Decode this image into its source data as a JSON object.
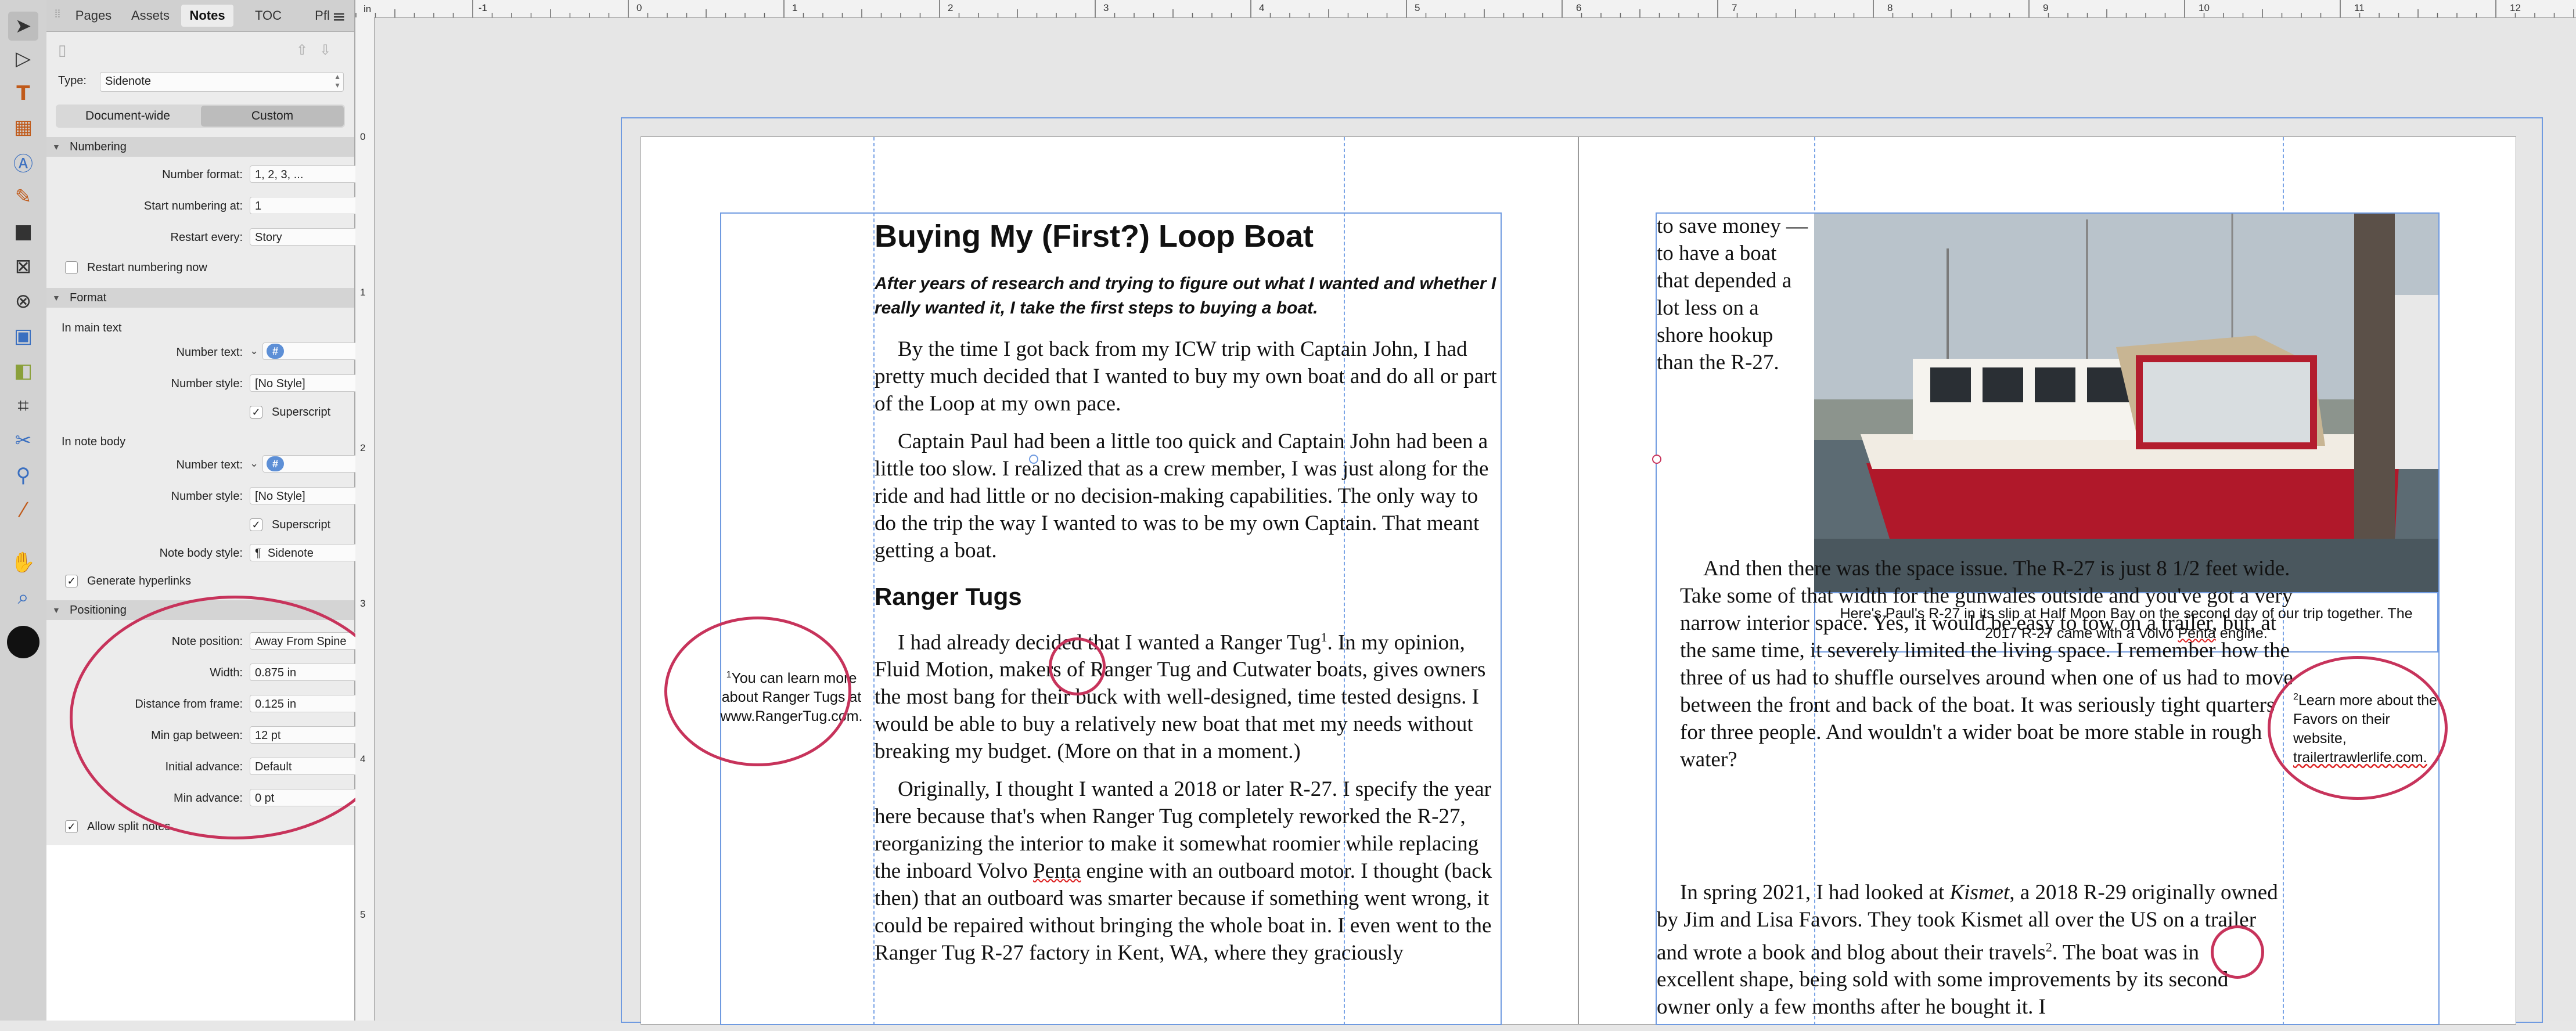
{
  "ruler": {
    "unit": "in",
    "top_labels": [
      "-1",
      "0",
      "1",
      "2",
      "3",
      "4",
      "5",
      "6",
      "7",
      "8",
      "9",
      "10",
      "11",
      "12"
    ],
    "left_labels": [
      "0",
      "1",
      "2",
      "3",
      "4",
      "5"
    ]
  },
  "panel": {
    "tabs": [
      "Pages",
      "Assets",
      "Notes",
      "TOC",
      "Pfl"
    ],
    "active_tab": "Notes",
    "type_label": "Type:",
    "type_value": "Sidenote",
    "scope": {
      "document_wide": "Document-wide",
      "custom": "Custom",
      "selected": "Custom"
    },
    "numbering": {
      "header": "Numbering",
      "format_label": "Number format:",
      "format_value": "1, 2, 3, ...",
      "start_label": "Start numbering at:",
      "start_value": "1",
      "restart_label": "Restart every:",
      "restart_value": "Story",
      "restart_now_label": "Restart numbering now"
    },
    "format": {
      "header": "Format",
      "main_text_label": "In main text",
      "number_text_label": "Number text:",
      "number_text_token": "#",
      "number_style_label": "Number style:",
      "number_style_value": "[No Style]",
      "superscript_label": "Superscript",
      "note_body_label": "In note body",
      "body_number_text_label": "Number text:",
      "body_number_text_token": "#",
      "body_number_style_label": "Number style:",
      "body_number_style_value": "[No Style]",
      "body_superscript_label": "Superscript",
      "note_body_style_label": "Note body style:",
      "note_body_style_value": "Sidenote",
      "pilcrow": "¶",
      "hyperlinks_label": "Generate hyperlinks"
    },
    "positioning": {
      "header": "Positioning",
      "note_position_label": "Note position:",
      "note_position_value": "Away From Spine",
      "width_label": "Width:",
      "width_value": "0.875 in",
      "distance_label": "Distance from frame:",
      "distance_value": "0.125 in",
      "min_gap_label": "Min gap between:",
      "min_gap_value": "12 pt",
      "initial_advance_label": "Initial advance:",
      "initial_advance_value": "Default",
      "min_advance_label": "Min advance:",
      "min_advance_value": "0 pt",
      "split_label": "Allow split notes"
    }
  },
  "document": {
    "left_page": {
      "title": "Buying My (First?) Loop Boat",
      "deck": "After years of research and trying to figure out what I wanted and whether I really wanted it, I take the first steps to buying a boat.",
      "para1": "By the time I got back from my ICW trip with Captain John, I had pretty much decided that I wanted to buy my own boat and do all or part of the Loop at my own pace.",
      "para2": "Captain Paul had been a little too quick and Captain John had been a little too slow. I realized that as a crew member, I was just along for the ride and had little or no decision-making capabilities. The only way to do the trip the way I wanted to was to be my own Captain. That meant getting a boat.",
      "subhead": "Ranger Tugs",
      "para3_before": "I had already decided that I wanted a Ranger Tug",
      "para3_ref": "1",
      "para3_after": ". In my opinion, Fluid Motion, makers of Ranger Tug and Cutwater boats, gives owners the most bang for their buck with well-designed, time tested designs. I would be able to buy a relatively new boat that met my needs without breaking my budget. (More on that in a moment.)",
      "para4_a": "Originally, I thought I wanted a 2018 or later R-27. I specify the year here because that's when Ranger Tug completely reworked the R-27, reorganizing the interior to make it somewhat roomier while replacing the inboard Volvo ",
      "para4_penta": "Penta",
      "para4_b": " engine with an outboard motor. I thought (back then) that an outboard was smarter because if something went wrong, it could be repaired without bringing the whole boat in. I even went to the Ranger Tug R-27 factory in Kent, WA, where they graciously",
      "sidenote1_num": "1",
      "sidenote1": "You can learn more about Ranger Tugs at www.RangerTug.com."
    },
    "right_page": {
      "col_text": "to save money — to have a boat that depended a lot less on a shore hookup than the R-27.",
      "para_space": "And then there was the space issue. The R-27 is just 8 1/2 feet wide. Take some of that width for the gunwales outside and you've got a very narrow interior space. Yes, it would be easy to tow on a trailer, but, at the same time, it severely limited the living space. I remember how the three of us had to shuffle ourselves around when one of us had to move between the front and back of the boat. It was seriously tight quarters for three people. And wouldn't a wider boat be more stable in rough water?",
      "para_spring_a": "In spring 2021, I had looked at ",
      "para_spring_kismet": "Kismet",
      "para_spring_b": ", a 2018 R-29 originally owned by Jim and Lisa Favors. They took Kismet all over the US on a trailer and wrote a book and blog about their travels",
      "para_spring_ref": "2",
      "para_spring_c": ". The boat was in excellent shape, being sold with some improvements by its second owner only a few months after he bought it. I",
      "caption_a": "Here's Paul's R-27 in its slip at Half Moon Bay on the second day of our trip together. The 2017 R-27 came with a Volvo ",
      "caption_penta": "Penta",
      "caption_b": " engine.",
      "sidenote2_num": "2",
      "sidenote2": "Learn more about the Favors on their website,",
      "sidenote2_link": "trailertrawlerlife.com."
    }
  },
  "colors": {
    "accent": "#6f9ae0",
    "annotation": "#c7335b",
    "panel": "#ececec"
  }
}
